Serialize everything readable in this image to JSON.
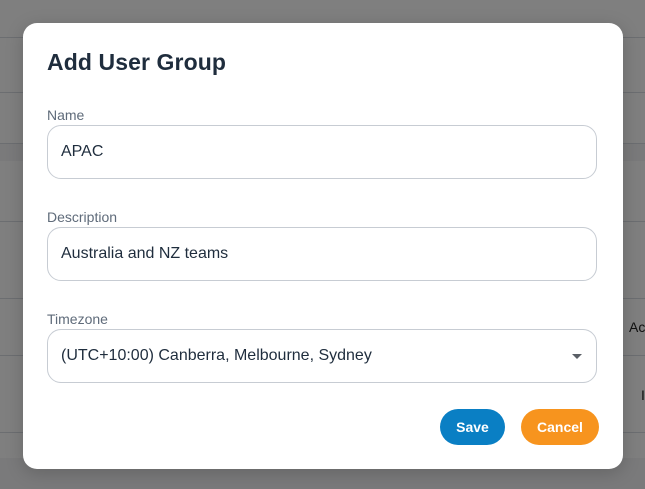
{
  "background": {
    "peek_texts": [
      "Ac",
      "I"
    ]
  },
  "dialog": {
    "title": "Add User Group",
    "fields": {
      "name": {
        "label": "Name",
        "value": "APAC"
      },
      "description": {
        "label": "Description",
        "value": "Australia and NZ teams"
      },
      "timezone": {
        "label": "Timezone",
        "value": "(UTC+10:00) Canberra, Melbourne, Sydney",
        "icon": "caret-down-icon"
      }
    },
    "buttons": {
      "save": {
        "label": "Save",
        "color": "#0a7fc4"
      },
      "cancel": {
        "label": "Cancel",
        "color": "#f7941e"
      }
    }
  }
}
